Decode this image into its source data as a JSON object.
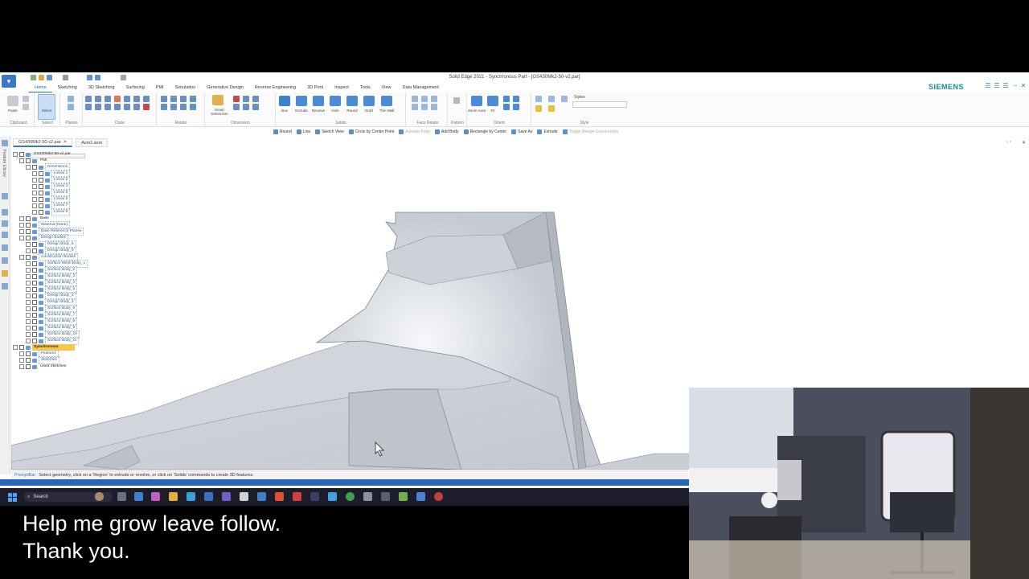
{
  "window": {
    "title": "Solid Edge 2021 - Synchronous Part - [GS430Mk2-50-v2.par]",
    "brand": "SIEMENS"
  },
  "ribbon_tabs": [
    "Home",
    "Sketching",
    "3D Sketching",
    "Surfacing",
    "PMI",
    "Simulation",
    "Generative Design",
    "Reverse Engineering",
    "3D Print",
    "Inspect",
    "Tools",
    "View",
    "Data Management"
  ],
  "ribbon": {
    "groups": [
      "Clipboard",
      "Select",
      "Planes",
      "Draw",
      "Relate",
      "Dimension",
      "Solids",
      "Face Relate",
      "Pattern",
      "Orient",
      "Style"
    ],
    "buttons": {
      "paste": "Paste",
      "select": "Select",
      "smart_dimension": "Smart Dimension",
      "box": "Box",
      "extrude": "Extrude",
      "revolve": "Revolve",
      "hole": "Hole",
      "round": "Round",
      "draft": "Draft",
      "thin_wall": "Thin Wall",
      "zoom_area": "Zoom Area",
      "fit": "Fit",
      "styles": "Styles"
    }
  },
  "command_bar": [
    {
      "label": "Round",
      "enabled": true
    },
    {
      "label": "Line",
      "enabled": true
    },
    {
      "label": "Sketch View",
      "enabled": true
    },
    {
      "label": "Circle by Center Point",
      "enabled": true
    },
    {
      "label": "Activate Body",
      "enabled": false
    },
    {
      "label": "Add Body",
      "enabled": true
    },
    {
      "label": "Rectangle by Center",
      "enabled": true
    },
    {
      "label": "Save As",
      "enabled": true
    },
    {
      "label": "Extrude",
      "enabled": true
    },
    {
      "label": "Toggle Design-Construction",
      "enabled": false
    }
  ],
  "doc_tabs": [
    {
      "label": "GS430Mk2-50-v2.par",
      "active": true
    },
    {
      "label": "Asm1.asm",
      "active": false
    }
  ],
  "left_strip_label": "Feature Library",
  "tree": [
    {
      "label": "GS430Mk2-50-v2.par",
      "indent": 0,
      "style": "plain"
    },
    {
      "label": "PMI",
      "indent": 1,
      "style": "plain"
    },
    {
      "label": "Dimensions",
      "indent": 2,
      "style": "link"
    },
    {
      "label": "Linear 1",
      "indent": 3,
      "style": "link"
    },
    {
      "label": "Linear 2",
      "indent": 3,
      "style": "link"
    },
    {
      "label": "Linear 3",
      "indent": 3,
      "style": "link"
    },
    {
      "label": "Linear 5",
      "indent": 3,
      "style": "link"
    },
    {
      "label": "Linear 6",
      "indent": 3,
      "style": "link"
    },
    {
      "label": "Linear 7",
      "indent": 3,
      "style": "link"
    },
    {
      "label": "Linear 9",
      "indent": 3,
      "style": "link"
    },
    {
      "label": "Base",
      "indent": 1,
      "style": "plain"
    },
    {
      "label": "Material (None)",
      "indent": 1,
      "style": "link"
    },
    {
      "label": "Base Reference Planes",
      "indent": 1,
      "style": "link"
    },
    {
      "label": "Design Bodies",
      "indent": 1,
      "style": "link"
    },
    {
      "label": "Design Body_5",
      "indent": 2,
      "style": "link"
    },
    {
      "label": "Design Body_9",
      "indent": 2,
      "style": "link"
    },
    {
      "label": "Construction Bodies",
      "indent": 1,
      "style": "link"
    },
    {
      "label": "Surface Mesh Body_1",
      "indent": 2,
      "style": "link"
    },
    {
      "label": "Surface Body_2",
      "indent": 2,
      "style": "link"
    },
    {
      "label": "Surface Body_3",
      "indent": 2,
      "style": "link"
    },
    {
      "label": "Surface Body_4",
      "indent": 2,
      "style": "link"
    },
    {
      "label": "Surface Body_5",
      "indent": 2,
      "style": "link"
    },
    {
      "label": "Design Body_3",
      "indent": 2,
      "style": "link"
    },
    {
      "label": "Design Body_4",
      "indent": 2,
      "style": "link"
    },
    {
      "label": "Surface Body_6",
      "indent": 2,
      "style": "link"
    },
    {
      "label": "Surface Body_7",
      "indent": 2,
      "style": "link"
    },
    {
      "label": "Surface Body_8",
      "indent": 2,
      "style": "link"
    },
    {
      "label": "Surface Body_9",
      "indent": 2,
      "style": "link"
    },
    {
      "label": "Surface Body_10",
      "indent": 2,
      "style": "link"
    },
    {
      "label": "Surface Body_11",
      "indent": 2,
      "style": "link"
    },
    {
      "label": "Synchronous",
      "indent": 0,
      "style": "highlight"
    },
    {
      "label": "Features",
      "indent": 1,
      "style": "link"
    },
    {
      "label": "Sketches",
      "indent": 1,
      "style": "link"
    },
    {
      "label": "Used Sketches",
      "indent": 1,
      "style": "plain"
    }
  ],
  "prompt_bar": {
    "label": "PromptBar",
    "message": "Select geometry, click on a 'Region' to extrude or revolve, or click on 'Solids' commands to create 3D features."
  },
  "taskbar": {
    "search_placeholder": "Search"
  },
  "caption": {
    "line1": "Help me grow leave follow.",
    "line2": "Thank you."
  },
  "colors": {
    "accent": "#1e6fc8",
    "status_bar": "#2867b7",
    "model_surface": "#cfd2d8",
    "tree_highlight": "#f7c94b"
  }
}
